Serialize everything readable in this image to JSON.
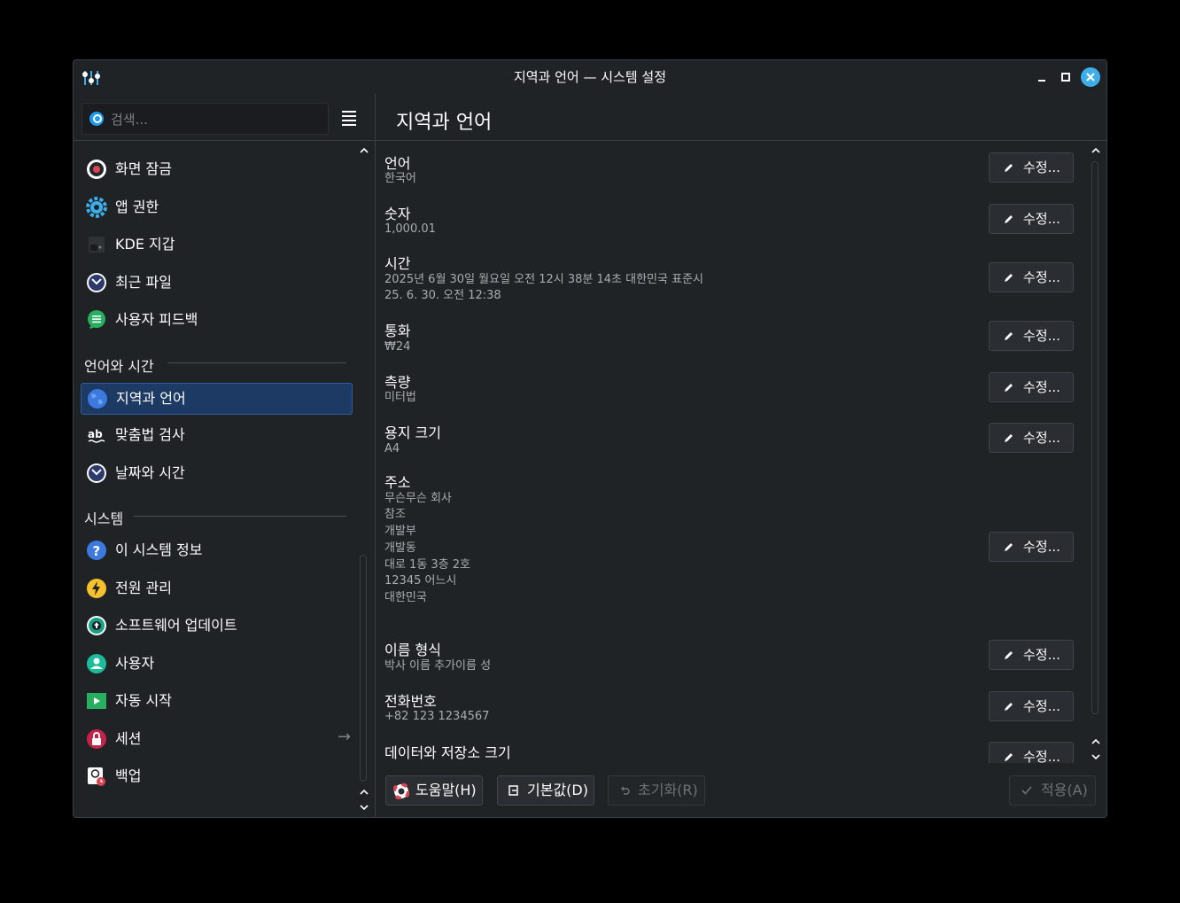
{
  "window": {
    "title": "지역과 언어 — 시스템 설정"
  },
  "search": {
    "placeholder": "검색..."
  },
  "sidebar": {
    "items_top": [
      {
        "label": "화면 잠금",
        "icon": "screen-lock-icon"
      },
      {
        "label": "앱 권한",
        "icon": "gear-icon"
      },
      {
        "label": "KDE 지갑",
        "icon": "wallet-icon"
      },
      {
        "label": "최근 파일",
        "icon": "clock-icon"
      },
      {
        "label": "사용자 피드백",
        "icon": "feedback-icon"
      }
    ],
    "section_lang": "언어와 시간",
    "items_lang": [
      {
        "label": "지역과 언어",
        "icon": "globe-icon",
        "active": true
      },
      {
        "label": "맞춤법 검사",
        "icon": "spellcheck-icon"
      },
      {
        "label": "날짜와 시간",
        "icon": "clock-icon"
      }
    ],
    "section_system": "시스템",
    "items_system": [
      {
        "label": "이 시스템 정보",
        "icon": "help-icon"
      },
      {
        "label": "전원 관리",
        "icon": "power-icon"
      },
      {
        "label": "소프트웨어 업데이트",
        "icon": "update-icon"
      },
      {
        "label": "사용자",
        "icon": "user-icon"
      },
      {
        "label": "자동 시작",
        "icon": "autostart-icon"
      },
      {
        "label": "세션",
        "icon": "lock-icon"
      },
      {
        "label": "백업",
        "icon": "backup-icon"
      }
    ],
    "session_arrow": "→"
  },
  "main": {
    "title": "지역과 언어",
    "rows": [
      {
        "title": "언어",
        "lines": [
          "한국어"
        ]
      },
      {
        "title": "숫자",
        "lines": [
          "1,000.01"
        ]
      },
      {
        "title": "시간",
        "lines": [
          "2025년 6월 30일 월요일 오전 12시 38분 14초 대한민국 표준시",
          "25. 6. 30. 오전 12:38"
        ]
      },
      {
        "title": "통화",
        "lines": [
          "₩24"
        ]
      },
      {
        "title": "측량",
        "lines": [
          "미터법"
        ]
      },
      {
        "title": "용지 크기",
        "lines": [
          "A4"
        ]
      },
      {
        "title": "주소",
        "lines": [
          "무슨무슨 회사",
          "참조",
          "개발부",
          "개발동",
          "대로 1동 3층 2호",
          "12345 어느시",
          "대한민국"
        ]
      },
      {
        "title": "이름 형식",
        "lines": [
          "박사 이름 추가이름 성"
        ]
      },
      {
        "title": "전화번호",
        "lines": [
          "+82 123 1234567"
        ]
      },
      {
        "title": "데이터와 저장소 크기",
        "lines": []
      }
    ],
    "edit_label": "수정..."
  },
  "bottom": {
    "help": "도움말(H)",
    "defaults": "기본값(D)",
    "reset": "초기화(R)",
    "apply": "적용(A)"
  },
  "colors": {
    "accent": "#3daee9",
    "active_bg": "#1c3a63",
    "bg": "#202326"
  }
}
